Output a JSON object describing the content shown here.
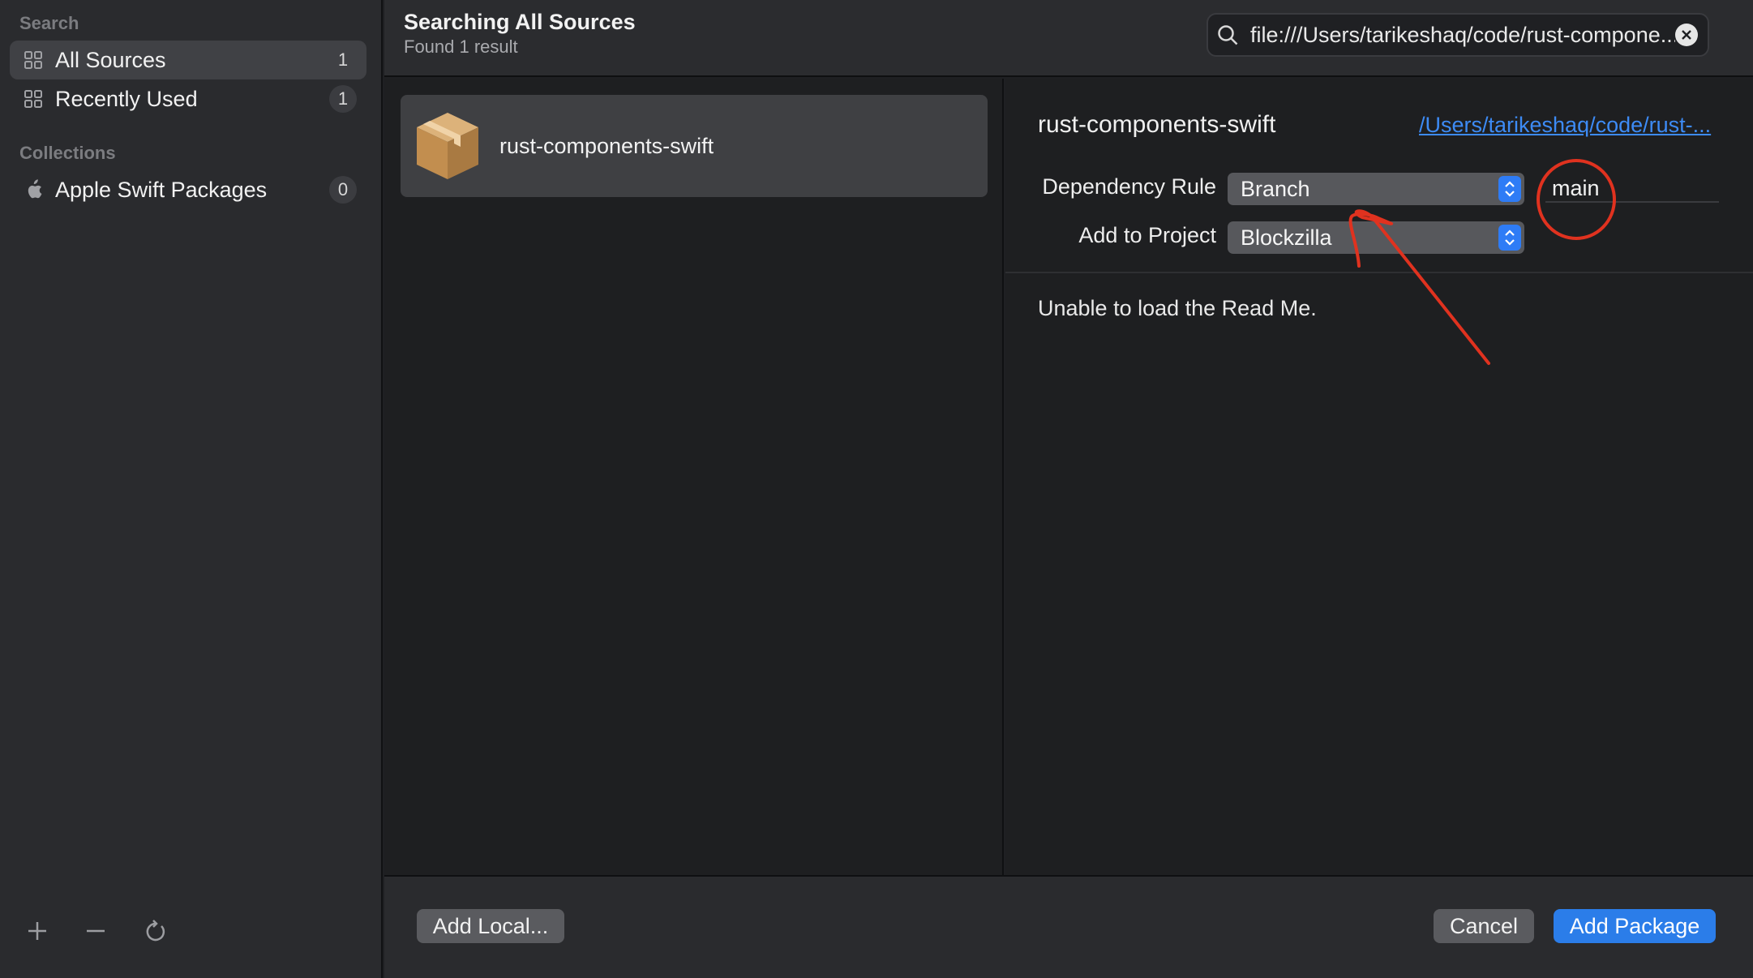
{
  "sidebar": {
    "search_heading": "Search",
    "items": [
      {
        "label": "All Sources",
        "count": "1"
      },
      {
        "label": "Recently Used",
        "count": "1"
      }
    ],
    "collections_heading": "Collections",
    "collections": [
      {
        "label": "Apple Swift Packages",
        "count": "0"
      }
    ]
  },
  "header": {
    "title": "Searching All Sources",
    "subtitle": "Found 1 result",
    "search_value": "file:///Users/tarikeshaq/code/rust-compone..."
  },
  "results": [
    {
      "name": "rust-components-swift"
    }
  ],
  "detail": {
    "name": "rust-components-swift",
    "link": "/Users/tarikeshaq/code/rust-...",
    "dependency_rule_label": "Dependency Rule",
    "dependency_rule_value": "Branch",
    "branch_value": "main",
    "add_to_project_label": "Add to Project",
    "add_to_project_value": "Blockzilla",
    "readme_text": "Unable to load the Read Me."
  },
  "footer": {
    "add_local": "Add Local...",
    "cancel": "Cancel",
    "add_package": "Add Package"
  },
  "colors": {
    "accent": "#2b7de9",
    "link": "#3d8bf5",
    "annotation": "#e0321f",
    "package_icon": "#c99a5b"
  }
}
